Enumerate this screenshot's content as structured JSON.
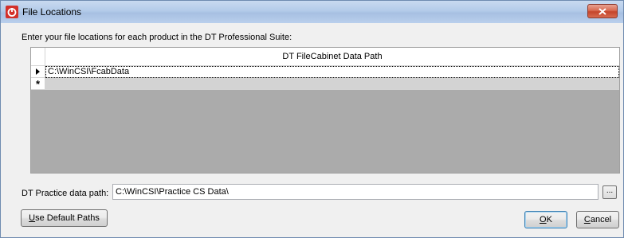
{
  "window": {
    "title": "File Locations"
  },
  "instruction": "Enter your file locations for each product in the DT Professional Suite:",
  "grid": {
    "column_header": "DT FileCabinet Data Path",
    "rows": [
      {
        "value": "C:\\WinCSI\\FcabData"
      }
    ],
    "new_row_marker": "*"
  },
  "practice_path": {
    "label": "DT Practice data path:",
    "value": "C:\\WinCSI\\Practice CS Data\\",
    "browse_label": "..."
  },
  "buttons": {
    "default_paths": {
      "mnemonic": "U",
      "rest": "se Default Paths"
    },
    "ok": {
      "mnemonic": "O",
      "rest": "K"
    },
    "cancel": {
      "mnemonic": "C",
      "rest": "ancel"
    }
  },
  "colors": {
    "close_button": "#c4452b",
    "app_icon": "#d3302a",
    "new_row_background": "#d3d3d3"
  },
  "icons": {
    "app": "app-logo-icon",
    "close": "close-icon",
    "row_pointer": "row-pointer-icon"
  }
}
